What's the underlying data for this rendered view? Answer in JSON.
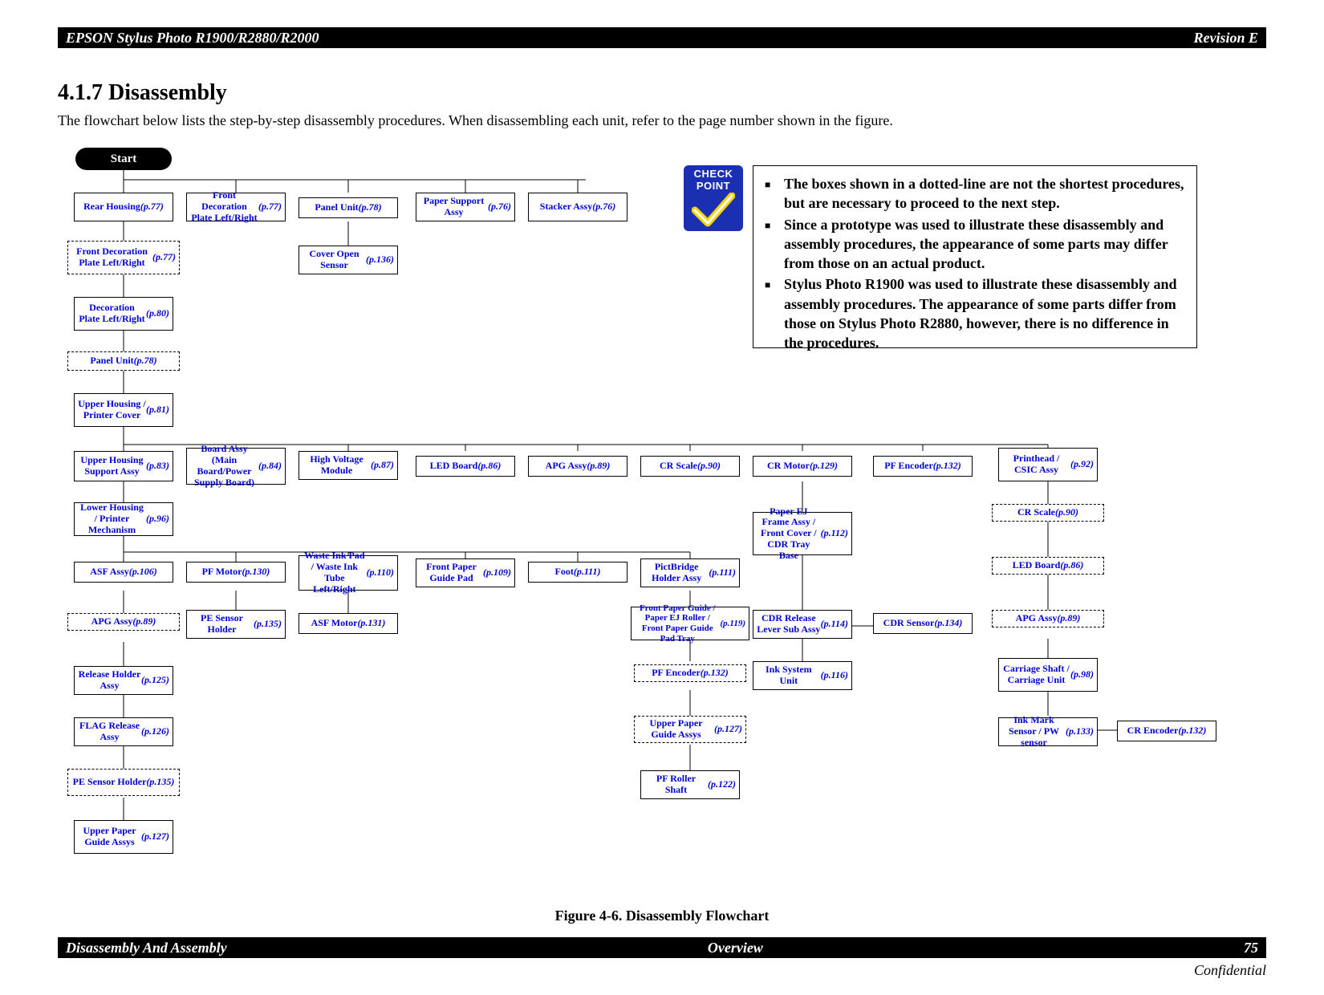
{
  "header": {
    "left": "EPSON Stylus Photo R1900/R2880/R2000",
    "right": "Revision E"
  },
  "footer": {
    "left": "Disassembly And Assembly",
    "center": "Overview",
    "right": "75"
  },
  "confidential": "Confidential",
  "title": "4.1.7  Disassembly",
  "intro": "The flowchart below lists the step-by-step disassembly procedures. When disassembling each unit, refer to the page number shown in the figure.",
  "caption": "Figure 4-6.  Disassembly Flowchart",
  "checkpoint": {
    "l1": "CHECK",
    "l2": "POINT"
  },
  "notes": [
    "The boxes shown in a dotted-line are not the shortest procedures, but are necessary to proceed to the next step.",
    "Since a prototype was used to illustrate these disassembly and assembly procedures, the appearance of some parts may differ from those on an actual product.",
    "Stylus Photo R1900 was used to illustrate these disassembly and assembly procedures. The appearance of some parts differ from those on Stylus Photo R2880, however, there is no difference in the procedures."
  ],
  "start": "Start",
  "boxes": {
    "rear_housing": "Rear Housing (p.77)",
    "front_deco_lr_top": "Front Decoration Plate Left/Right (p.77)",
    "panel_unit_top": "Panel Unit (p.78)",
    "paper_support": "Paper Support Assy (p.76)",
    "stacker": "Stacker Assy (p.76)",
    "front_deco_lr": "Front Decoration Plate Left/Right (p.77)",
    "cover_open": "Cover Open Sensor (p.136)",
    "deco_plate_lr": "Decoration Plate Left/Right (p.80)",
    "panel_unit": "Panel Unit (p.78)",
    "upper_housing_cover": "Upper Housing / Printer Cover (p.81)",
    "upper_housing_support": "Upper Housing Support Assy (p.83)",
    "board_assy": "Board Assy (Main Board/Power Supply Board) (p.84)",
    "hvm": "High Voltage Module (p.87)",
    "led_board": "LED Board (p.86)",
    "apg_assy": "APG Assy (p.89)",
    "cr_scale": "CR Scale (p.90)",
    "cr_motor": "CR Motor (p.129)",
    "pf_encoder": "PF Encoder (p.132)",
    "printhead": "Printhead / CSIC Assy (p.92)",
    "lower_housing": "Lower Housing / Printer Mechanism (p.96)",
    "paper_ej": "Paper EJ Frame Assy / Front Cover / CDR Tray Base (p.112)",
    "cr_scale2": "CR Scale (p.90)",
    "asf_assy": "ASF Assy (p.106)",
    "pf_motor": "PF Motor (p.130)",
    "waste_ink": "Waste Ink Pad / Waste Ink Tube Left/Right (p.110)",
    "front_paper_guide_pad": "Front Paper Guide Pad (p.109)",
    "foot": "Foot (p.111)",
    "pictbridge": "PictBridge Holder Assy (p.111)",
    "led_board2": "LED Board (p.86)",
    "apg_assy2": "APG Assy (p.89)",
    "pe_sensor": "PE Sensor Holder (p.135)",
    "asf_motor": "ASF Motor (p.131)",
    "front_paper_guide_tray": "Front Paper Guide / Paper EJ Roller / Front Paper Guide Pad Tray (p.119)",
    "cdr_release": "CDR Release Lever Sub Assy (p.114)",
    "cdr_sensor": "CDR Sensor (p.134)",
    "apg_assy3": "APG Assy (p.89)",
    "release_holder": "Release Holder Assy (p.125)",
    "pf_encoder2": "PF Encoder (p.132)",
    "ink_system": "Ink System Unit (p.116)",
    "carriage_shaft": "Carriage Shaft / Carriage Unit (p.98)",
    "flag_release": "FLAG Release Assy (p.126)",
    "upper_paper_guide": "Upper Paper Guide Assys (p.127)",
    "ink_mark": "Ink Mark Sensor / PW sensor (p.133)",
    "cr_encoder": "CR Encoder (p.132)",
    "pe_sensor2": "PE Sensor Holder (p.135)",
    "pf_roller": "PF Roller Shaft (p.122)",
    "upper_paper_guide2": "Upper Paper Guide Assys (p.127)"
  }
}
